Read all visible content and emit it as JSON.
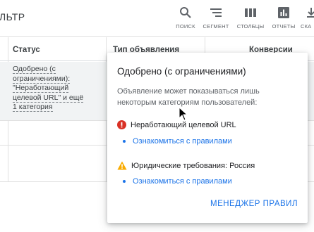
{
  "toolbar": {
    "filter_label": "ЛЬТР",
    "tools": [
      {
        "label": "ПОИСК",
        "icon": "search-icon"
      },
      {
        "label": "СЕГМЕНТ",
        "icon": "segment-icon"
      },
      {
        "label": "СТОЛБЦЫ",
        "icon": "columns-icon"
      },
      {
        "label": "ОТЧЕТЫ",
        "icon": "reports-icon"
      },
      {
        "label": "СКА",
        "icon": "download-icon"
      }
    ]
  },
  "table": {
    "columns": {
      "status": "Статус",
      "ad_type": "Тип объявления",
      "conversions": "Конверсии"
    },
    "rows": [
      {
        "status_lines": [
          "Одобрено (с",
          "ограничениями):",
          "\"Неработающий",
          "целевой URL\" и ещё",
          "1 категория"
        ]
      }
    ]
  },
  "popup": {
    "title": "Одобрено (с ограничениями)",
    "description": "Объявление может показываться лишь некоторым категориям пользователей:",
    "issues": [
      {
        "icon": "error-icon",
        "label": "Неработающий целевой URL",
        "link": "Ознакомиться с правилами"
      },
      {
        "icon": "warning-icon",
        "label": "Юридические требования: Россия",
        "link": "Ознакомиться с правилами"
      }
    ],
    "action_label": "МЕНЕДЖЕР ПРАВИЛ"
  },
  "colors": {
    "accent": "#1a73e8",
    "error": "#d93025",
    "warning": "#f9ab00",
    "selected_row": "#f1f3f4"
  }
}
